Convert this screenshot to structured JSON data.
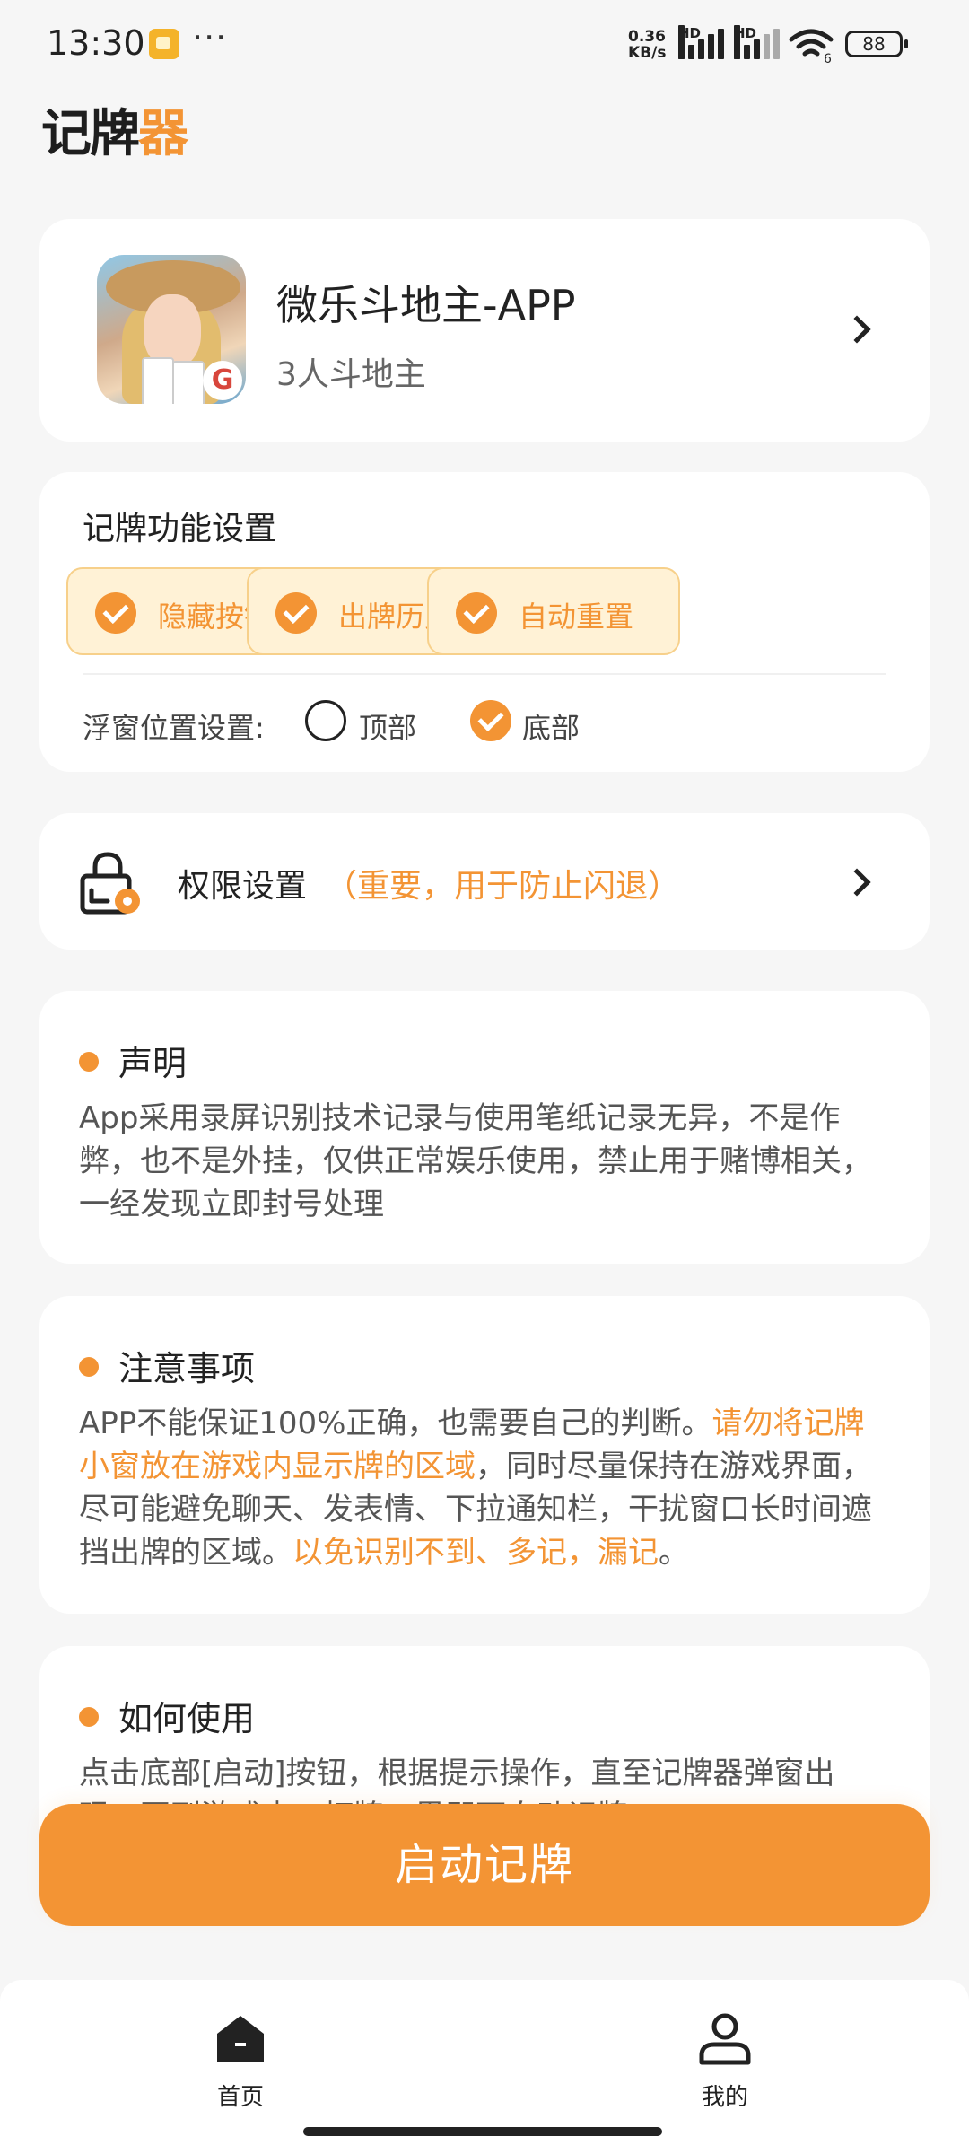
{
  "status_bar": {
    "time": "13:30",
    "more": "···",
    "speed_value": "0.36",
    "speed_unit": "KB/s",
    "sig1_hd": "HD",
    "sig2_hd": "HD",
    "wifi_sub": "6",
    "battery": "88"
  },
  "app": {
    "logo_part1": "记牌",
    "logo_part2": "器",
    "accent_color": "#f39434"
  },
  "game": {
    "title": "微乐斗地主-APP",
    "subtitle": "3人斗地主",
    "badge": "G"
  },
  "settings": {
    "title": "记牌功能设置",
    "options": [
      {
        "label": "隐藏按钮",
        "checked": true
      },
      {
        "label": "出牌历史",
        "checked": true
      },
      {
        "label": "自动重置",
        "checked": true
      }
    ],
    "float_label": "浮窗位置设置:",
    "position_top": "顶部",
    "position_bottom": "底部",
    "selected_position": "底部"
  },
  "permission": {
    "label": "权限设置",
    "note": "（重要，用于防止闪退）"
  },
  "statement": {
    "title": "声明",
    "body": "App采用录屏识别技术记录与使用笔纸记录无异，不是作弊，也不是外挂，仅供正常娱乐使用，禁止用于赌博相关，一经发现立即封号处理"
  },
  "notice": {
    "title": "注意事项",
    "body_1": "APP不能保证100%正确，也需要自己的判断。",
    "body_2": "请勿将记牌小窗放在游戏内显示牌的区域",
    "body_3": "，同时尽量保持在游戏界面，尽可能避免聊天、发表情、下拉通知栏，干扰窗口长时间遮挡出牌的区域。",
    "body_4": "以免识别不到、多记，漏记",
    "body_5": "。"
  },
  "howto": {
    "title": "如何使用",
    "body": "点击底部[启动]按钮，根据提示操作，直至记牌器弹窗出现，再到游戏中，打牌，界即可自动记牌"
  },
  "start_button": "启动记牌",
  "nav": {
    "home": "首页",
    "me": "我的"
  }
}
